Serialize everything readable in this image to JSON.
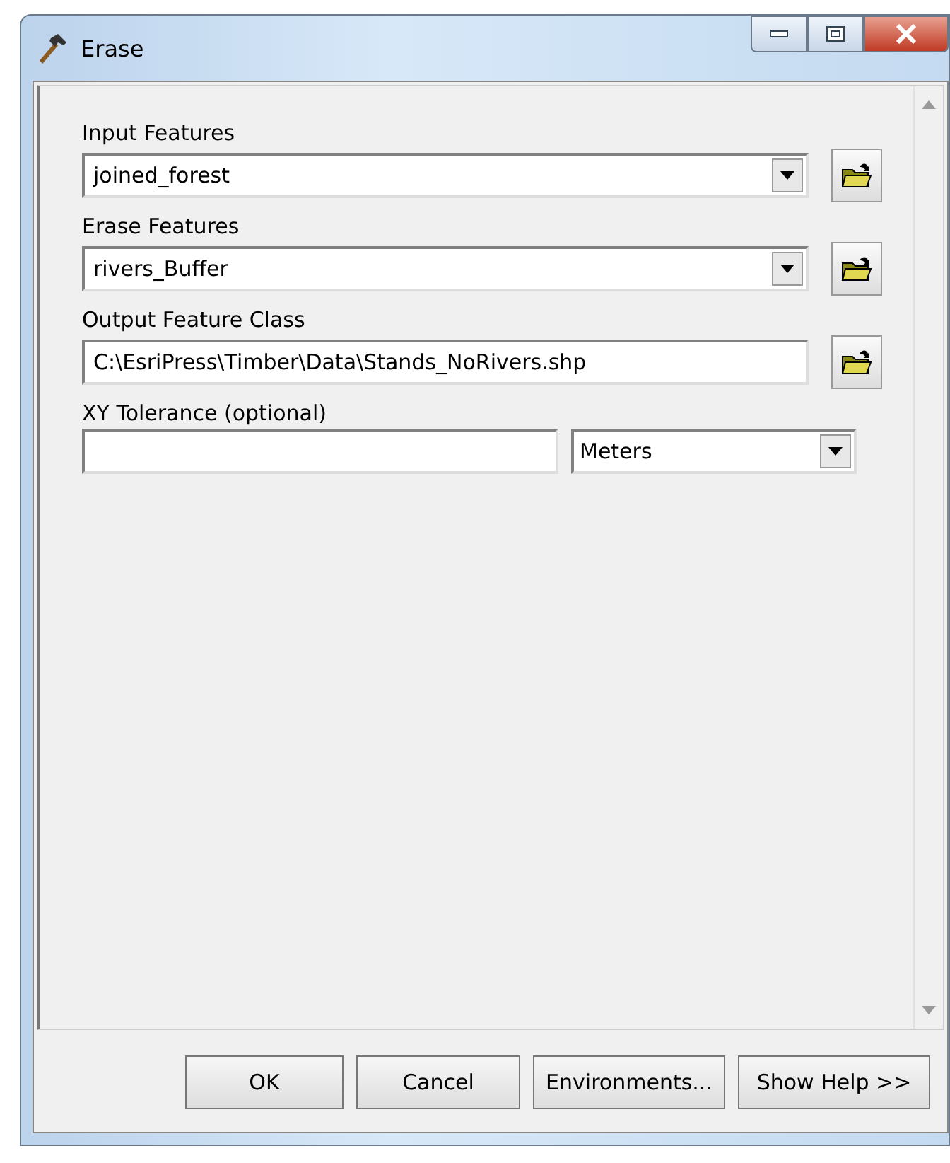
{
  "window": {
    "title": "Erase"
  },
  "parameters": [
    {
      "label": "Input Features",
      "kind": "combo",
      "value": "joined_forest"
    },
    {
      "label": "Erase Features",
      "kind": "combo",
      "value": "rivers_Buffer"
    },
    {
      "label": "Output Feature Class",
      "kind": "path",
      "value": "C:\\EsriPress\\Timber\\Data\\Stands_NoRivers.shp"
    },
    {
      "label": "XY Tolerance (optional)",
      "kind": "unit",
      "unit": "Meters"
    }
  ],
  "buttons": [
    "OK",
    "Cancel",
    "Environments...",
    "Show Help >>"
  ]
}
